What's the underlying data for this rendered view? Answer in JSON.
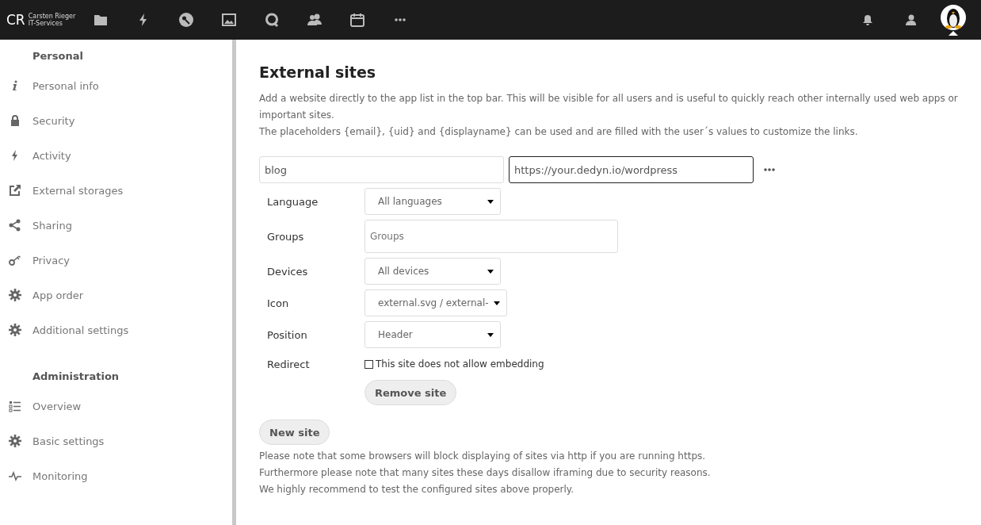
{
  "header": {
    "logo": {
      "initials": "CR",
      "line_1": "Carsten Rieger",
      "line_2": "IT-Services"
    },
    "apps": [
      {
        "kind": "files"
      },
      {
        "kind": "activity"
      },
      {
        "kind": "passwords"
      },
      {
        "kind": "gallery"
      },
      {
        "kind": "talk"
      },
      {
        "kind": "contacts"
      },
      {
        "kind": "calendar"
      },
      {
        "kind": "more"
      }
    ],
    "actions": [
      {
        "kind": "notifications"
      },
      {
        "kind": "contacts-menu"
      },
      {
        "kind": "avatar"
      }
    ]
  },
  "sidebar": {
    "sections": [
      {
        "title": "Personal",
        "items": [
          {
            "label": "Personal info",
            "kind": "info"
          },
          {
            "label": "Security",
            "kind": "lock"
          },
          {
            "label": "Activity",
            "kind": "bolt"
          },
          {
            "label": "External storages",
            "kind": "external"
          },
          {
            "label": "Sharing",
            "kind": "share"
          },
          {
            "label": "Privacy",
            "kind": "key"
          },
          {
            "label": "App order",
            "kind": "gear"
          },
          {
            "label": "Additional settings",
            "kind": "gear"
          }
        ]
      },
      {
        "title": "Administration",
        "items": [
          {
            "label": "Overview",
            "kind": "list"
          },
          {
            "label": "Basic settings",
            "kind": "gear"
          },
          {
            "label": "Monitoring",
            "kind": "pulse"
          }
        ]
      }
    ]
  },
  "content": {
    "title": "External sites",
    "description": [
      "Add a website directly to the app list in the top bar. This will be visible for all users and is useful to quickly reach other internally used web apps or important sites.",
      "The placeholders {email}, {uid} and {displayname} can be used and are filled with the user´s values to customize the links."
    ],
    "site": {
      "name": "blog",
      "url": "https://your.dedyn.io/wordpress",
      "fields": [
        {
          "label": "Language",
          "kind": "select",
          "value": "All languages"
        },
        {
          "label": "Groups",
          "kind": "tags",
          "placeholder": "Groups"
        },
        {
          "label": "Devices",
          "kind": "select",
          "value": "All devices"
        },
        {
          "label": "Icon",
          "kind": "select",
          "value": "external.svg / external-"
        },
        {
          "label": "Position",
          "kind": "select",
          "value": "Header"
        },
        {
          "label": "Redirect",
          "kind": "checkbox",
          "text": "This site does not allow embedding",
          "checked": false
        }
      ],
      "remove_button": "Remove site"
    },
    "new_button": "New site",
    "notes": [
      "Please note that some browsers will block displaying of sites via http if you are running https.",
      "Furthermore please note that many sites these days disallow iframing due to security reasons.",
      "We highly recommend to test the configured sites above properly."
    ]
  }
}
